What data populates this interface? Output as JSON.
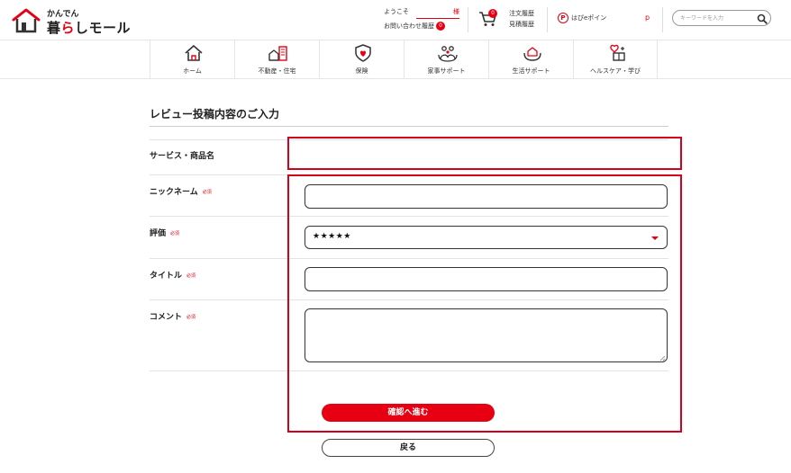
{
  "brand": {
    "small": "かんでん",
    "main_pre": "暮",
    "main_accent": "ら",
    "main_post": "しモール",
    "accent_color": "#e60012"
  },
  "header": {
    "welcome": "ようこそ",
    "honorific": "様",
    "inquiry_label": "お問い合わせ履歴",
    "inquiry_count": "0",
    "cart_count": "0",
    "order_history": "注文履歴",
    "estimate_history": "見積履歴",
    "points_label": "はぴeポイン",
    "points_unit": "p",
    "search_placeholder": "キーワードを入力",
    "icons": [
      "house-logo-icon",
      "cart-icon",
      "points-icon",
      "search-icon"
    ]
  },
  "nav": [
    {
      "label": "ホーム",
      "icon": "home-icon"
    },
    {
      "label": "不動産・住宅",
      "icon": "building-icon"
    },
    {
      "label": "保険",
      "icon": "shield-heart-icon"
    },
    {
      "label": "家事サポート",
      "icon": "family-icon"
    },
    {
      "label": "生活サポート",
      "icon": "hands-house-icon"
    },
    {
      "label": "ヘルスケア・学び",
      "icon": "health-book-icon"
    }
  ],
  "form": {
    "title": "レビュー投稿内容のご入力",
    "required_badge": "必須",
    "product_label": "サービス・商品名",
    "nickname_label": "ニックネーム",
    "rating_label": "評価",
    "rating_value": "★★★★★",
    "title_label": "タイトル",
    "comment_label": "コメント",
    "confirm_button": "確認へ進む",
    "back_button": "戻る"
  },
  "colors": {
    "accent": "#e60012",
    "highlight": "#d6001c"
  }
}
